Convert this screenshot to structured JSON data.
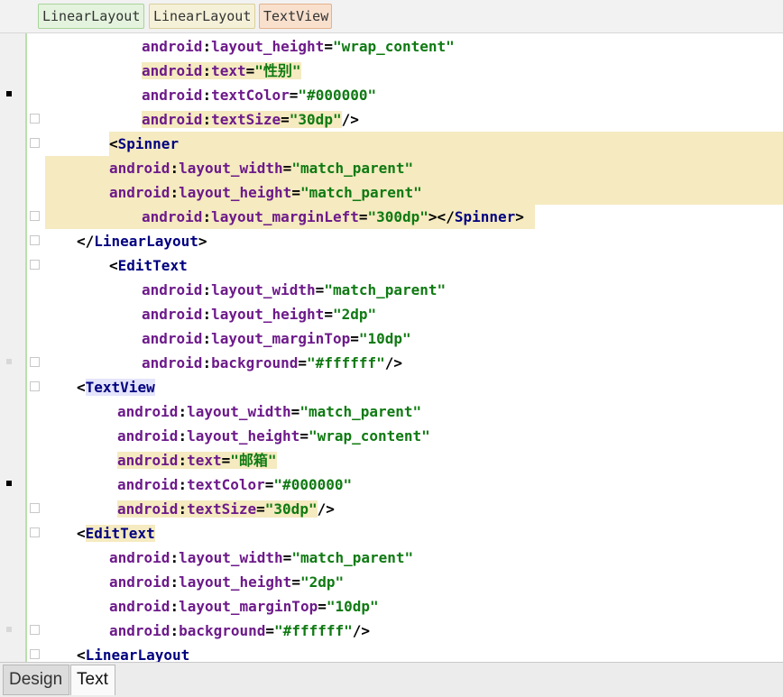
{
  "breadcrumb": [
    "LinearLayout",
    "LinearLayout",
    "TextView"
  ],
  "tabs": {
    "design": "Design",
    "text": "Text",
    "active": "Text"
  },
  "colors": {
    "highlight": "#f5eac0",
    "tag_highlight": "#e4e4fb",
    "attribute": "#6d1a8a",
    "string_value": "#0f7a12",
    "tag_name": "#000080"
  },
  "code_lines": [
    "android:layout_height=\"wrap_content\"",
    "android:text=\"性别\"",
    "android:textColor=\"#000000\"",
    "android:textSize=\"30dp\"/>",
    "<Spinner",
    "android:layout_width=\"match_parent\"",
    "android:layout_height=\"match_parent\"",
    "android:layout_marginLeft=\"300dp\"></Spinner>",
    "</LinearLayout>",
    "<EditText",
    "android:layout_width=\"match_parent\"",
    "android:layout_height=\"2dp\"",
    "android:layout_marginTop=\"10dp\"",
    "android:background=\"#ffffff\"/>",
    "<TextView",
    "android:layout_width=\"match_parent\"",
    "android:layout_height=\"wrap_content\"",
    "android:text=\"邮箱\"",
    "android:textColor=\"#000000\"",
    "android:textSize=\"30dp\"/>",
    "<EditText",
    "android:layout_width=\"match_parent\"",
    "android:layout_height=\"2dp\"",
    "android:layout_marginTop=\"10dp\"",
    "android:background=\"#ffffff\"/>",
    "<LinearLayout"
  ]
}
